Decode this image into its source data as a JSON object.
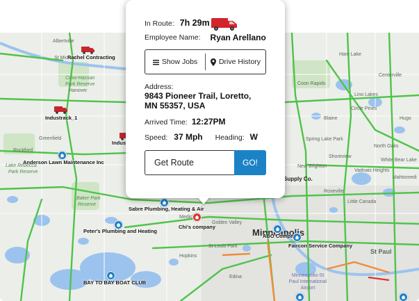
{
  "popup": {
    "in_route_label": "In Route:",
    "in_route_value": "7h 29m",
    "employee_label": "Employee Name:",
    "employee_value": "Ryan Arellano",
    "show_jobs": "Show Jobs",
    "drive_history": "Drive History",
    "address_label": "Address:",
    "address_line1": "9843 Pioneer Trail, Loretto,",
    "address_line2": "MN 55357, USA",
    "arrived_label": "Arrived Time:",
    "arrived_value": "12:27PM",
    "speed_label": "Speed:",
    "speed_value": "37 Mph",
    "heading_label": "Heading:",
    "heading_value": "W",
    "route_input_value": "Get Route",
    "go_label": "GO!"
  },
  "map": {
    "vehicles": [
      {
        "label": "Rachel Contracting"
      },
      {
        "label": "Industrack_1"
      },
      {
        "label": "Indus"
      }
    ],
    "businesses": [
      {
        "label": "Anderson Lawn Maintenance Inc"
      },
      {
        "label": "Sabre Plumbing, Heating & Air"
      },
      {
        "label": "Peter's Plumbing and Heating"
      },
      {
        "label": "BAY TO BAY BOAT CLUB"
      },
      {
        "label": "Chi's company"
      },
      {
        "label": "ABO Company"
      },
      {
        "label": "Faircon Service Company"
      }
    ],
    "places": {
      "albertville": "Albertville",
      "st_michael": "St Michael",
      "crow_hassan": "Crow-Hassan",
      "park_reserve": "Park Reserve",
      "hanover": "Hanover",
      "rockford": "Rockford",
      "greenfield": "Greenfield",
      "lake_rebecca": "Lake Rebecca",
      "park_reserve2": "Park Reserve",
      "baker": "Baker Park",
      "reserve": "Reserve",
      "medicine": "Medicine",
      "golden_valley": "Golden Valley",
      "minneapolis": "Minneapolis",
      "st_louis_park": "St Louis Park",
      "st_paul": "St Paul",
      "new_brighton": "New Brighton",
      "spring_lake": "Spring Lake Park",
      "blaine": "Blaine",
      "lino_lakes": "Lino Lakes",
      "centerville": "Centerville",
      "circle_pines": "Circle Pines",
      "shoreview": "Shoreview",
      "vadnais": "Vadnais Heights",
      "north_oaks": "North Oaks",
      "roseville": "Roseville",
      "hugo": "Hugo",
      "white_bear": "White Bear Lake",
      "little_canada": "Little Canada",
      "mahtomedi": "Mahtomedi",
      "supply": "Supply Co.",
      "airport": "Minneapolis-St Paul International Airport",
      "hopkins": "Hopkins",
      "edina": "Edina",
      "ham_lake": "Ham Lake",
      "coon_rapids": "Coon Rapids"
    }
  }
}
